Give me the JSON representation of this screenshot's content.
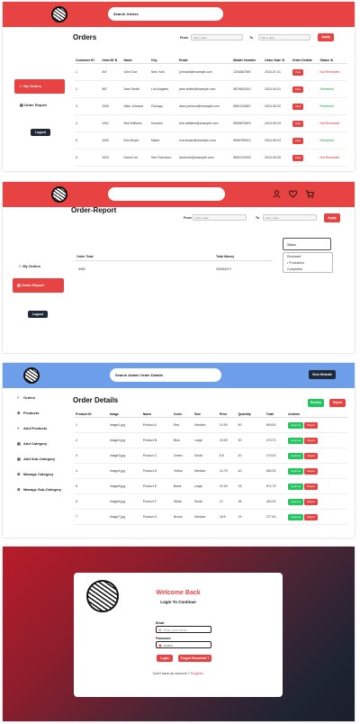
{
  "orders": {
    "search_placeholder": "Search Orders",
    "sidebar": {
      "my_orders": "My Orders",
      "order_report": "Order Report",
      "logout": "Logout"
    },
    "title": "Orders",
    "filter": {
      "from_label": "From",
      "to_label": "To",
      "from_placeholder": "Pick a date",
      "to_placeholder": "Pick a date",
      "apply": "Apply"
    },
    "columns": [
      "Customer ID",
      "OrderID ⇅",
      "Name",
      "City",
      "Email",
      "Mobile Number",
      "Order Date ⇅",
      "Order Details",
      "Status ⇅"
    ],
    "view_label": "View",
    "rows": [
      {
        "cid": "1",
        "oid": "267",
        "name": "John Doe",
        "city": "New York",
        "email": "johndoe@example.com",
        "mobile": "1234567890",
        "date": "2024-07-31",
        "status": "Not Reviewed",
        "ok": false
      },
      {
        "cid": "1",
        "oid": "987",
        "name": "Jane Smith",
        "city": "Los Angeles",
        "email": "jane.smith@example.com",
        "mobile": "9876543210",
        "date": "2024-04-01",
        "status": "Reviewed",
        "ok": true
      },
      {
        "cid": "3",
        "oid": "1000",
        "name": "Alice Johnson",
        "city": "Chicago",
        "email": "alice.johnson@example.com",
        "mobile": "5551234567",
        "date": "2024-05-02",
        "status": "Reviewed",
        "ok": true
      },
      {
        "cid": "4",
        "oid": "1001",
        "name": "Bob Williams",
        "city": "Houston",
        "email": "bob.williams@example.com",
        "mobile": "5559876543",
        "date": "2024-05-03",
        "status": "Not Reviewed",
        "ok": false
      },
      {
        "cid": "5",
        "oid": "1002",
        "name": "Eva Brown",
        "city": "Miami",
        "email": "eva.brown@example.com",
        "mobile": "5556789012",
        "date": "2024-05-04",
        "status": "Reviewed",
        "ok": true
      },
      {
        "cid": "6",
        "oid": "1003",
        "name": "David Lee",
        "city": "San Francisco",
        "email": "david.lee@example.com",
        "mobile": "5552223333",
        "date": "2024-05-05",
        "status": "Not Reviewed",
        "ok": false
      }
    ]
  },
  "report": {
    "title": "Order-Report",
    "sidebar": {
      "my_orders": "My Orders",
      "order_report": "Order-Report",
      "logout": "Logout"
    },
    "filter": {
      "from_label": "From",
      "to_label": "To",
      "from_placeholder": "Pick a date",
      "to_placeholder": "Pick a date",
      "apply": "Apply"
    },
    "status_select": "Status",
    "status_options": [
      "Reviewed",
      "Production",
      "Completed"
    ],
    "selected_option": "Production",
    "columns": [
      "Order Total",
      "Total Money"
    ],
    "row": {
      "total": "9960",
      "money": "3000618 ₹"
    },
    "icons": [
      "user-icon",
      "heart-icon",
      "cart-icon"
    ]
  },
  "admin": {
    "search_placeholder": "Search Admin Order Details",
    "view_website": "View Website",
    "title": "Order Details",
    "review_btn": "Review",
    "reject_btn": "Reject",
    "sidebar": [
      {
        "icon": "≡",
        "label": "Orders"
      },
      {
        "icon": "⚙",
        "label": "Products"
      },
      {
        "icon": "+",
        "label": "Add Products"
      },
      {
        "icon": "▤",
        "label": "Add Category"
      },
      {
        "icon": "▤",
        "label": "Add Sub-Category"
      },
      {
        "icon": "⚙",
        "label": "Manage Category"
      },
      {
        "icon": "⚙",
        "label": "Manage Sub-Category"
      }
    ],
    "columns": [
      "Product ID",
      "Image",
      "Name",
      "Color",
      "Size",
      "Price",
      "Quantity",
      "Total",
      "Actions"
    ],
    "approve_label": "Approve",
    "reject_label": "Reject",
    "rows": [
      {
        "id": "1",
        "image": "image1.jpg",
        "name": "Product A",
        "color": "Red",
        "size": "Medium",
        "price": "10.99",
        "qty": "50",
        "total": "549.50"
      },
      {
        "id": "2",
        "image": "image2.jpg",
        "name": "Product B",
        "color": "Blue",
        "size": "Large",
        "price": "15.99",
        "qty": "30",
        "total": "479.70"
      },
      {
        "id": "3",
        "image": "image3.jpg",
        "name": "Product C",
        "color": "Green",
        "size": "Small",
        "price": "8.5",
        "qty": "20",
        "total": "170.00"
      },
      {
        "id": "4",
        "image": "image4.jpg",
        "name": "Product D",
        "color": "Yellow",
        "size": "Medium",
        "price": "14.75",
        "qty": "40",
        "total": "590.00"
      },
      {
        "id": "5",
        "image": "image5.jpg",
        "name": "Product E",
        "color": "Black",
        "size": "Large",
        "price": "22.99",
        "qty": "25",
        "total": "574.75"
      },
      {
        "id": "6",
        "image": "image6.jpg",
        "name": "Product F",
        "color": "White",
        "size": "Small",
        "price": "12",
        "qty": "35",
        "total": "420.00"
      },
      {
        "id": "7",
        "image": "image7.jpg",
        "name": "Product G",
        "color": "Brown",
        "size": "Medium",
        "price": "18.5",
        "qty": "15",
        "total": "277.50"
      }
    ]
  },
  "login": {
    "title": "Welcome Back",
    "subtitle": "Login To Continue",
    "email_label": "Email",
    "email_placeholder": "Enter your email",
    "password_label": "Password",
    "password_value": "••••••••",
    "login_btn": "Login",
    "forgot_btn": "Forgot Password ?",
    "no_account": "Don't have an account ?",
    "register": "Register"
  },
  "colors": {
    "red": "#e84343",
    "green": "#22c55e",
    "blue": "#6d9eea",
    "dark": "#1f2937"
  }
}
